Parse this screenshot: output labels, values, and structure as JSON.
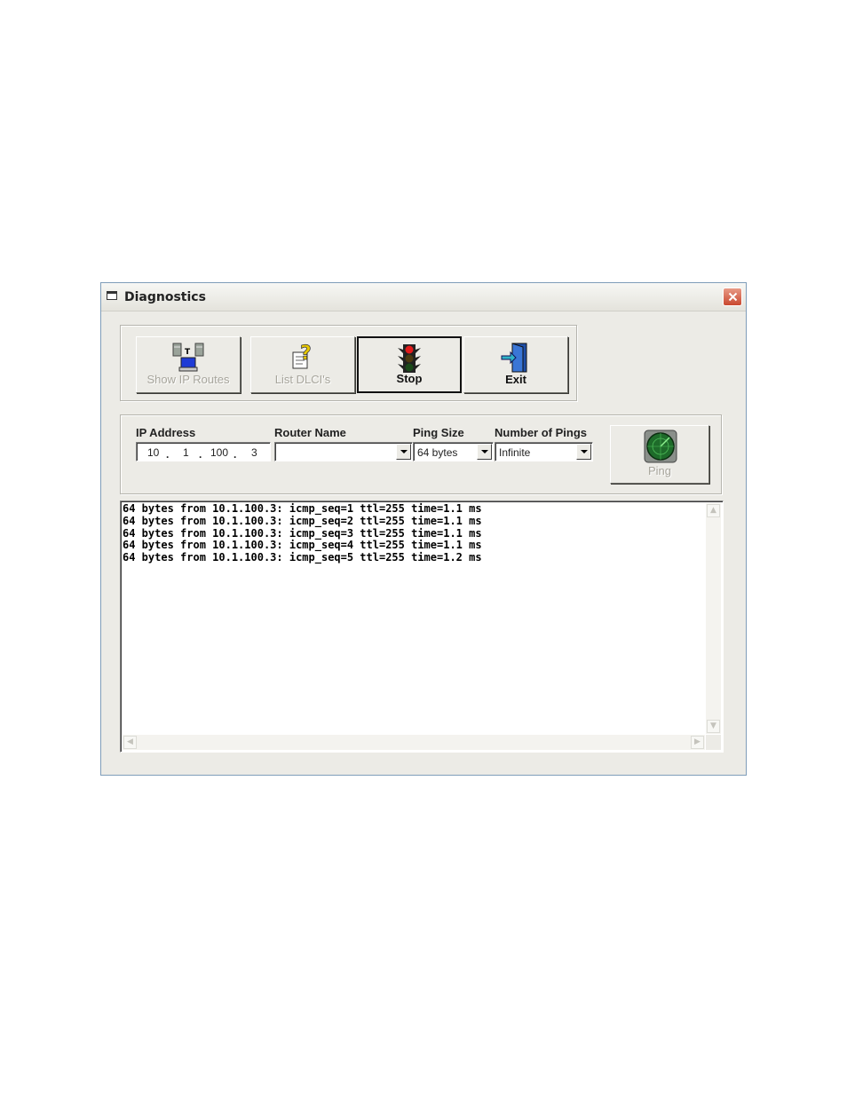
{
  "window": {
    "title": "Diagnostics"
  },
  "toolbar": {
    "show_ip_routes": "Show IP Routes",
    "list_dlcis": "List DLCI's",
    "stop": "Stop",
    "exit": "Exit"
  },
  "form": {
    "ip_address_label": "IP Address",
    "ip": {
      "oct1": "10",
      "oct2": "1",
      "oct3": "100",
      "oct4": "3",
      "dot": "."
    },
    "router_name_label": "Router Name",
    "router_name_value": "",
    "ping_size_label": "Ping Size",
    "ping_size_value": "64 bytes",
    "num_pings_label": "Number of Pings",
    "num_pings_value": "Infinite",
    "ping_button": "Ping"
  },
  "output": {
    "text": "64 bytes from 10.1.100.3: icmp_seq=1 ttl=255 time=1.1 ms\n64 bytes from 10.1.100.3: icmp_seq=2 ttl=255 time=1.1 ms\n64 bytes from 10.1.100.3: icmp_seq=3 ttl=255 time=1.1 ms\n64 bytes from 10.1.100.3: icmp_seq=4 ttl=255 time=1.1 ms\n64 bytes from 10.1.100.3: icmp_seq=5 ttl=255 time=1.2 ms"
  },
  "colors": {
    "window_bg": "#ecebe6",
    "close_red": "#c9482f",
    "disabled_text": "#a7a59c"
  },
  "icons": [
    "window-icon",
    "close-icon",
    "network-computers-icon",
    "question-document-icon",
    "traffic-light-icon",
    "exit-door-icon",
    "radar-icon",
    "scroll-up-icon",
    "scroll-down-icon",
    "scroll-left-icon",
    "scroll-right-icon"
  ]
}
